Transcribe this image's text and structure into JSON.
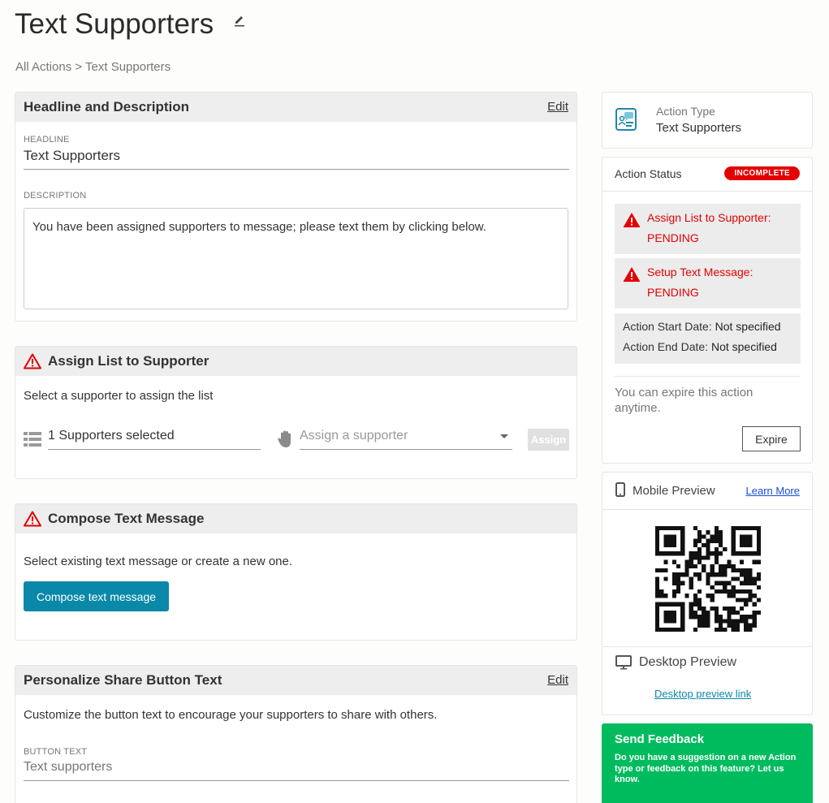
{
  "page": {
    "title": "Text Supporters",
    "breadcrumb": "All Actions > Text Supporters"
  },
  "headline_card": {
    "title": "Headline and Description",
    "edit": "Edit",
    "headline_label": "HEADLINE",
    "headline_value": "Text Supporters",
    "description_label": "DESCRIPTION",
    "description_value": "You have been assigned supporters to message; please text them by clicking below."
  },
  "assign_card": {
    "title": "Assign List to Supporter",
    "instruction": "Select a supporter to assign the list",
    "list_value": "1 Supporters selected",
    "supporter_placeholder": "Assign a supporter",
    "assign_button": "Assign"
  },
  "compose_card": {
    "title": "Compose Text Message",
    "instruction": "Select existing text message or create a new one.",
    "compose_button": "Compose text message"
  },
  "share_card": {
    "title": "Personalize Share Button Text",
    "edit": "Edit",
    "instruction": "Customize the button text to encourage your supporters to share with others.",
    "button_text_label": "BUTTON TEXT",
    "button_text_value": "Text supporters"
  },
  "action_type": {
    "label": "Action Type",
    "value": "Text Supporters"
  },
  "action_status": {
    "label": "Action Status",
    "badge": "INCOMPLETE",
    "items": [
      {
        "line1": "Assign List to Supporter:",
        "line2": "PENDING"
      },
      {
        "line1": "Setup Text Message:",
        "line2": "PENDING"
      }
    ],
    "start_label": "Action Start Date:",
    "start_value": "Not specified",
    "end_label": "Action End Date:",
    "end_value": "Not specified",
    "expire_note": "You can expire this action anytime.",
    "expire_button": "Expire"
  },
  "preview": {
    "mobile_label": "Mobile Preview",
    "learn_more": "Learn More",
    "desktop_label": "Desktop Preview",
    "desktop_link": "Desktop preview link"
  },
  "feedback": {
    "title": "Send Feedback",
    "text": "Do you have a suggestion on a new Action type or feedback on this feature? Let us know."
  },
  "colors": {
    "accent": "#0a88a8",
    "danger": "#e30000",
    "feedback": "#00bb5e",
    "link": "#1a4fd6"
  }
}
